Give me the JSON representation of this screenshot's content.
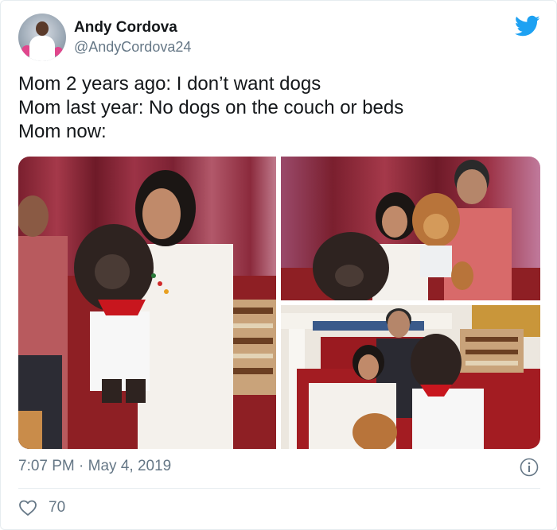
{
  "user": {
    "display_name": "Andy Cordova",
    "handle": "@AndyCordova24",
    "avatar": "avatar"
  },
  "tweet": {
    "lines": [
      "Mom 2 years ago: I don’t want dogs",
      "Mom last year: No dogs on the couch or beds",
      "Mom now:"
    ]
  },
  "media": {
    "photos": [
      "photo-mom-holding-poodle",
      "photo-family-on-couch-with-dogs",
      "photo-family-with-dogs-by-fireplace"
    ]
  },
  "footer": {
    "timestamp": "7:07 PM · May 4, 2019",
    "like_count": "70"
  },
  "icons": {
    "logo": "twitter-bird-icon",
    "info": "info-icon",
    "like": "heart-icon"
  },
  "colors": {
    "twitter_blue": "#1da1f2",
    "muted_text": "#657786",
    "primary_text": "#14171a"
  }
}
